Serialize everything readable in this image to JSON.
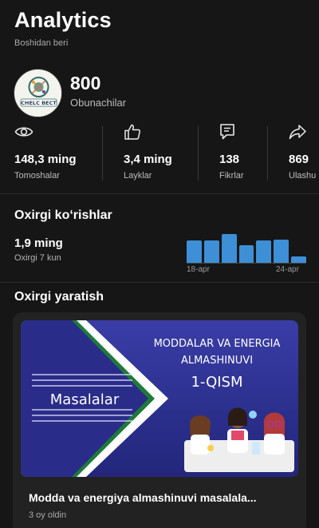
{
  "header": {
    "title": "Analytics",
    "subtitle": "Boshidan beri"
  },
  "channel": {
    "avatar_text": "CHELC BECT",
    "subscribers": "800",
    "subscribers_label": "Obunachilar"
  },
  "stats": [
    {
      "icon": "eye-icon",
      "value": "148,3 ming",
      "label": "Tomoshalar"
    },
    {
      "icon": "thumbs-up-icon",
      "value": "3,4 ming",
      "label": "Layklar"
    },
    {
      "icon": "comment-icon",
      "value": "138",
      "label": "Fikrlar"
    },
    {
      "icon": "share-icon",
      "value": "869",
      "label": "Ulashu"
    }
  ],
  "recent_views": {
    "title": "Oxirgi ko‘rishlar",
    "value": "1,9 ming",
    "period": "Oxirgi 7 kun",
    "x_start": "18-apr",
    "x_end": "24-apr",
    "bar_color": "#3d8fd6"
  },
  "chart_data": {
    "type": "bar",
    "categories": [
      "18-apr",
      "19-apr",
      "20-apr",
      "21-apr",
      "22-apr",
      "23-apr",
      "24-apr"
    ],
    "values": [
      0.78,
      0.78,
      1.0,
      0.62,
      0.78,
      0.8,
      0.22
    ]
  },
  "latest": {
    "title": "Oxirgi yaratish",
    "video_title": "Modda va energiya almashinuvi masalala...",
    "age": "3 oy oldin",
    "thumb": {
      "line1": "MODDALAR VA ENERGIA",
      "line2": "ALMASHINUVI",
      "part": "1-QISM",
      "left_word": "Masalalar"
    }
  }
}
